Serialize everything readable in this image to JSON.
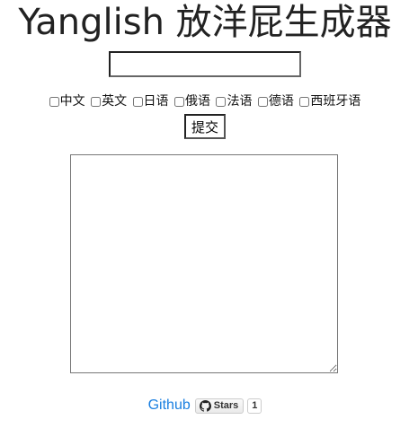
{
  "title": "Yanglish 放洋屁生成器",
  "input": {
    "value": "",
    "placeholder": ""
  },
  "languages": [
    "中文",
    "英文",
    "日语",
    "俄语",
    "法语",
    "德语",
    "西班牙语"
  ],
  "submit_label": "提交",
  "output": {
    "value": ""
  },
  "footer": {
    "github_label": "Github",
    "stars_label": "Stars",
    "stars_count": "1"
  }
}
